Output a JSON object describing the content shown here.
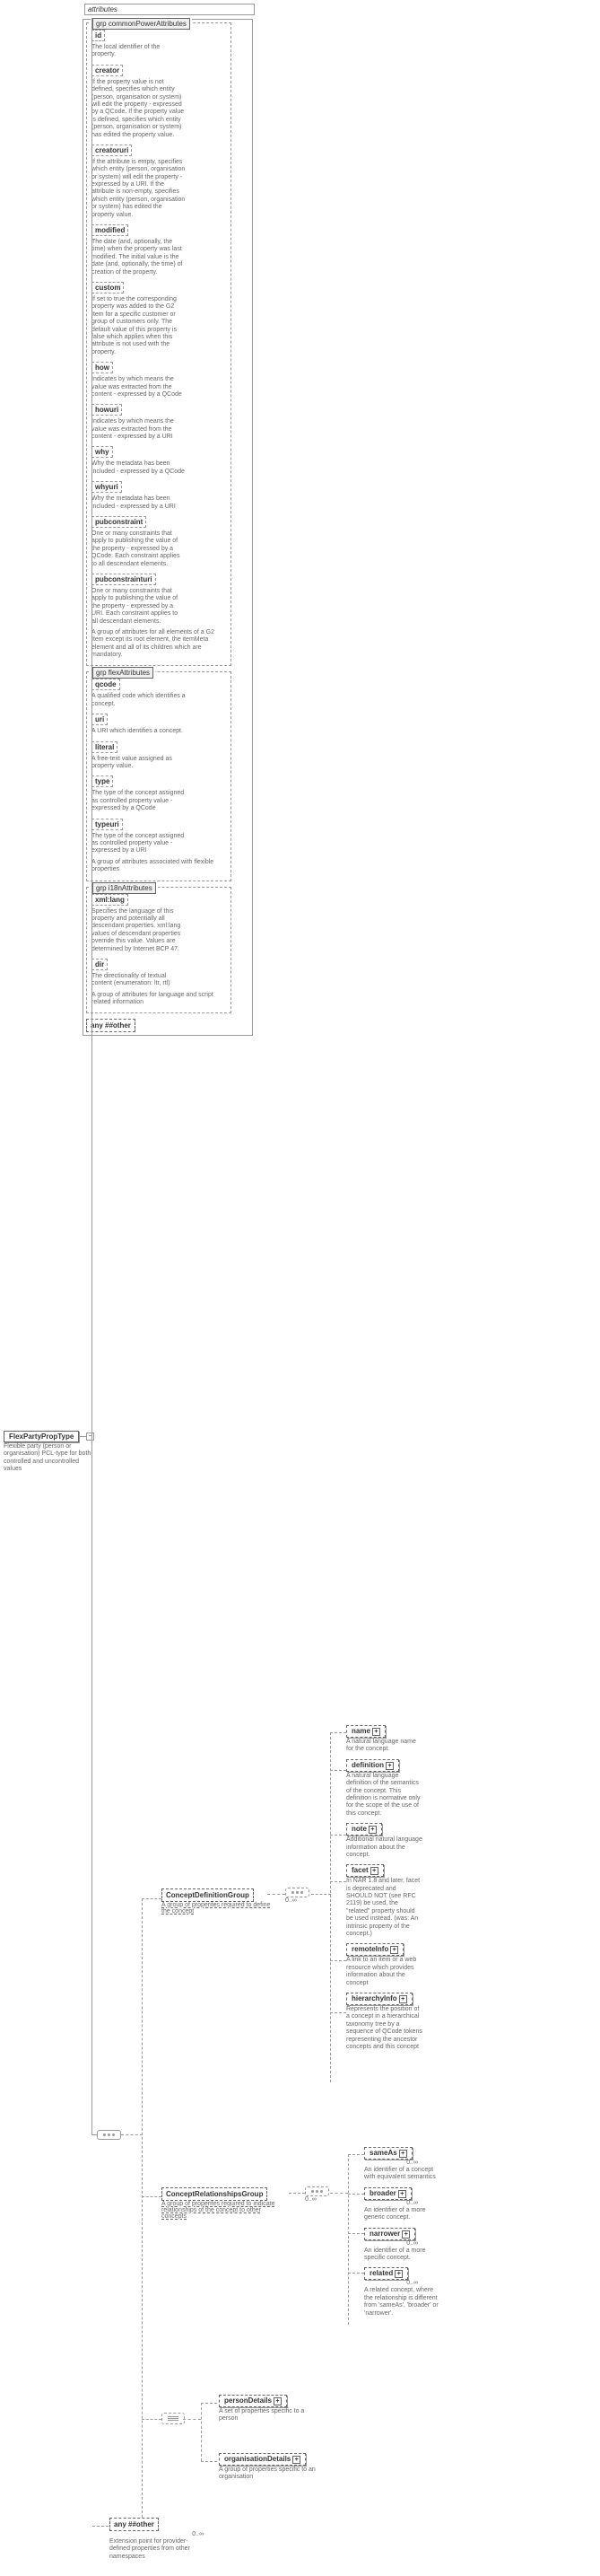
{
  "root": {
    "name": "FlexPartyPropType",
    "desc": "Flexible party (person or organisation) PCL-type for both controlled and uncontrolled values"
  },
  "attributes_label": "attributes",
  "common": {
    "header": "grp commonPowerAttributes",
    "items": [
      {
        "name": "id",
        "desc": "The local identifier of the property."
      },
      {
        "name": "creator",
        "desc": "If the property value is not defined, specifies which entity (person, organisation or system) will edit the property - expressed by a QCode. If the property value is defined, specifies which entity (person, organisation or system) has edited the property value."
      },
      {
        "name": "creatoruri",
        "desc": "If the attribute is empty, specifies which entity (person, organisation or system) will edit the property - expressed by a URI. If the attribute is non-empty, specifies which entity (person, organisation or system) has edited the property value."
      },
      {
        "name": "modified",
        "desc": "The date (and, optionally, the time) when the property was last modified. The initial value is the date (and, optionally, the time) of creation of the property."
      },
      {
        "name": "custom",
        "desc": "If set to true the corresponding property was added to the G2 Item for a specific customer or group of customers only. The default value of this property is false which applies when this attribute is not used with the property."
      },
      {
        "name": "how",
        "desc": "Indicates by which means the value was extracted from the content - expressed by a QCode"
      },
      {
        "name": "howuri",
        "desc": "Indicates by which means the value was extracted from the content - expressed by a URI"
      },
      {
        "name": "why",
        "desc": "Why the metadata has been included - expressed by a QCode"
      },
      {
        "name": "whyuri",
        "desc": "Why the metadata has been included - expressed by a URI"
      },
      {
        "name": "pubconstraint",
        "desc": "One or many constraints that apply to publishing the value of the property - expressed by a QCode. Each constraint applies to all descendant elements."
      },
      {
        "name": "pubconstrainturi",
        "desc": "One or many constraints that apply to publishing the value of the property - expressed by a URI. Each constraint applies to all descendant elements."
      }
    ],
    "footer": "A group of attributes for all elements of a G2 Item except its root element, the itemMeta element and all of its children which are mandatory."
  },
  "flex": {
    "header": "grp flexAttributes",
    "items": [
      {
        "name": "qcode",
        "desc": "A qualified code which identifies a concept."
      },
      {
        "name": "uri",
        "desc": "A URI which identifies a concept."
      },
      {
        "name": "literal",
        "desc": "A free-text value assigned as property value."
      },
      {
        "name": "type",
        "desc": "The type of the concept assigned as controlled property value - expressed by a QCode"
      },
      {
        "name": "typeuri",
        "desc": "The type of the concept assigned as controlled property value - expressed by a URI"
      }
    ],
    "footer": "A group of attributes associated with flexible properties"
  },
  "i18n": {
    "header": "grp i18nAttributes",
    "items": [
      {
        "name": "xml:lang",
        "desc": "Specifies the language of this property and potentially all descendant properties. xml:lang values of descendant properties override this value. Values are determined by Internet BCP 47."
      },
      {
        "name": "dir",
        "desc": "The directionality of textual content (enumeration: ltr, rtl)"
      }
    ],
    "footer": "A group of attributes for language and script related information"
  },
  "any_other": "any  ##other",
  "cdg": {
    "name": "ConceptDefinitionGroup",
    "desc": "A group of properites required to define the concept",
    "children": [
      {
        "name": "name",
        "desc": "A natural language name for the concept."
      },
      {
        "name": "definition",
        "desc": "A natural language definition of the semantics of the concept. This definition is normative only for the scope of the use of this concept."
      },
      {
        "name": "note",
        "desc": "Additional natural language information about the concept."
      },
      {
        "name": "facet",
        "desc": "In NAR 1.8 and later, facet is deprecated and SHOULD NOT (see RFC 2119) be used, the \"related\" property should be used instead. (was: An intrinsic property of the concept.)"
      },
      {
        "name": "remoteInfo",
        "desc": "A link to an item or a web resource which provides information about the concept"
      },
      {
        "name": "hierarchyInfo",
        "desc": "Represents the position of a concept in a hierarchical taxonomy tree by a sequence of QCode tokens representing the ancestor concepts and this concept"
      }
    ]
  },
  "crg": {
    "name": "ConceptRelationshipsGroup",
    "desc": "A group of properites required to indicate relationships of the concept to other concepts",
    "children": [
      {
        "name": "sameAs",
        "desc": "An identifier of a concept with equivalent semantics"
      },
      {
        "name": "broader",
        "desc": "An identifier of a more generic concept."
      },
      {
        "name": "narrower",
        "desc": "An identifier of a more specific concept."
      },
      {
        "name": "related",
        "desc": "A related concept, where the relationship is different from 'sameAs', 'broader' or 'narrower'."
      }
    ]
  },
  "tail": {
    "person": {
      "name": "personDetails",
      "desc": "A set of properties specific to a person"
    },
    "org": {
      "name": "organisationDetails",
      "desc": "A group of properties specific to an organisation"
    },
    "any": {
      "name": "any  ##other",
      "desc": "Extension point for provider-defined properties from other namespaces"
    }
  },
  "mult": {
    "zero_inf": "0..∞"
  }
}
